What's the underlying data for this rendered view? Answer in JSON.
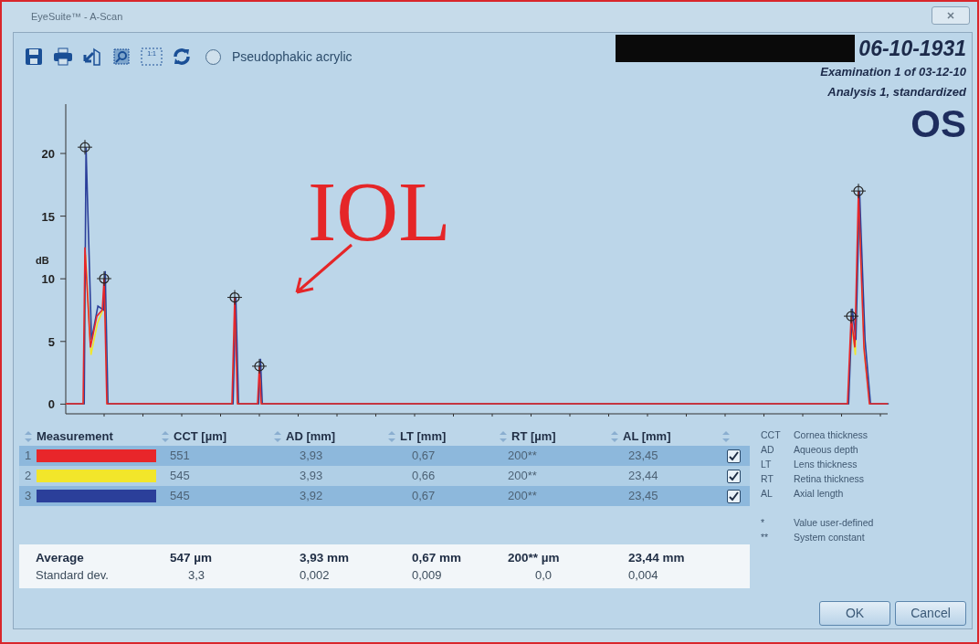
{
  "window": {
    "title": "EyeSuite™ - A-Scan"
  },
  "toolbar": [
    {
      "kind": "save"
    },
    {
      "kind": "print"
    },
    {
      "kind": "export"
    },
    {
      "kind": "zoom"
    },
    {
      "kind": "actual-size",
      "label": "1:1"
    },
    {
      "kind": "refresh"
    }
  ],
  "lens_option": {
    "label": "Pseudophakic acrylic",
    "selected": false
  },
  "header": {
    "date": "06-10-1931",
    "examination": "Examination 1 of 03-12-10",
    "analysis": "Analysis 1, standardized",
    "eye": "OS"
  },
  "chart": {
    "ylabel": "dB",
    "yticks": [
      "20",
      "15",
      "10",
      "5",
      "0"
    ]
  },
  "annotation": {
    "text": "IOL"
  },
  "table": {
    "columns": [
      "Measurement",
      "CCT [µm]",
      "AD [mm]",
      "LT [mm]",
      "RT [µm]",
      "AL [mm]"
    ],
    "rows": [
      {
        "index": "1",
        "color": "#e8262a",
        "cct": "551",
        "ad": "3,93",
        "lt": "0,67",
        "rt": "200**",
        "al": "23,45",
        "checked": true
      },
      {
        "index": "2",
        "color": "#f2e62a",
        "cct": "545",
        "ad": "3,93",
        "lt": "0,66",
        "rt": "200**",
        "al": "23,44",
        "checked": true
      },
      {
        "index": "3",
        "color": "#2b3f9a",
        "cct": "545",
        "ad": "3,92",
        "lt": "0,67",
        "rt": "200**",
        "al": "23,45",
        "checked": true
      }
    ]
  },
  "summary": [
    {
      "label": "Average",
      "values": [
        "547 µm",
        "3,93 mm",
        "0,67 mm",
        "200** µm",
        "23,44 mm"
      ]
    },
    {
      "label": "Standard dev.",
      "values": [
        "3,3",
        "0,002",
        "0,009",
        "0,0",
        "0,004"
      ]
    }
  ],
  "legend": [
    {
      "abbr": "CCT",
      "text": "Cornea thickness"
    },
    {
      "abbr": "AD",
      "text": "Aqueous depth"
    },
    {
      "abbr": "LT",
      "text": "Lens thickness"
    },
    {
      "abbr": "RT",
      "text": "Retina thickness"
    },
    {
      "abbr": "AL",
      "text": "Axial length"
    }
  ],
  "notes": [
    {
      "mark": "*",
      "text": "Value user-defined"
    },
    {
      "mark": "**",
      "text": "System constant"
    }
  ],
  "buttons": [
    "OK",
    "Cancel"
  ]
}
